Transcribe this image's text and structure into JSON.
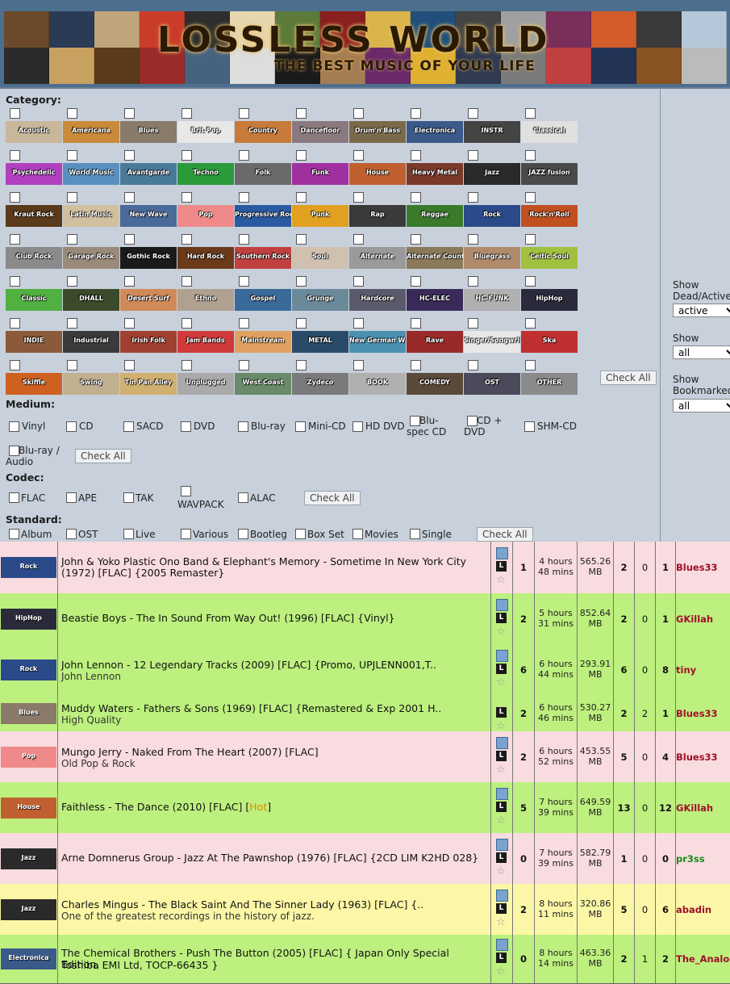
{
  "banner": {
    "title": "LOSSLESS WORLD",
    "subtitle": "THE BEST MUSIC OF YOUR LIFE",
    "colors": [
      "#6a4a2a",
      "#2b3a55",
      "#bfa57a",
      "#c93c2a",
      "#2e2e2e",
      "#e7d7b0",
      "#5c7a3a",
      "#8b1e1e",
      "#d9b44a",
      "#1f4f7a",
      "#444444",
      "#a0a0a0",
      "#7a2e5a",
      "#d35d2a",
      "#3a3a3a",
      "#b5c7d8",
      "#2a2a2a",
      "#c8a060",
      "#5a3a1a",
      "#9b2a2a",
      "#46627e",
      "#ddd",
      "#1a1a1a",
      "#a67c52",
      "#6a2a6a",
      "#e0b030",
      "#303a50",
      "#7a7a7a",
      "#c04040",
      "#223355",
      "#885522",
      "#bbbbbb"
    ]
  },
  "filters": {
    "category_label": "Category:",
    "medium_label": "Medium:",
    "codec_label": "Codec:",
    "standard_label": "Standard:",
    "check_all": "Check All",
    "categories": [
      [
        {
          "n": "Acoustic",
          "c": "#c8b79a"
        },
        {
          "n": "Americana",
          "c": "#c98a3a"
        },
        {
          "n": "Blues",
          "c": "#8a7a6a"
        },
        {
          "n": "Brit Pop",
          "c": "#e8e8e8"
        },
        {
          "n": "Country",
          "c": "#c77a3a"
        },
        {
          "n": "Dancefloor",
          "c": "#8a7a80"
        },
        {
          "n": "Drum'n'Bass",
          "c": "#7a6a4a"
        },
        {
          "n": "Electronica",
          "c": "#3a5a8a"
        },
        {
          "n": "INSTR",
          "c": "#444444"
        },
        {
          "n": "Classical",
          "c": "#e0e0e0"
        }
      ],
      [
        {
          "n": "Psychedelic",
          "c": "#b040c0"
        },
        {
          "n": "World Music",
          "c": "#5a90c0"
        },
        {
          "n": "Avantgarde",
          "c": "#4a7a9a"
        },
        {
          "n": "Techno",
          "c": "#2a9a3a"
        },
        {
          "n": "Folk",
          "c": "#6a6a6a"
        },
        {
          "n": "Funk",
          "c": "#a030a0"
        },
        {
          "n": "House",
          "c": "#c06030"
        },
        {
          "n": "Heavy Metal",
          "c": "#7a3a2a"
        },
        {
          "n": "Jazz",
          "c": "#2a2a2a"
        },
        {
          "n": "JAZZ fusion",
          "c": "#4a4a4a"
        }
      ],
      [
        {
          "n": "Kraut Rock",
          "c": "#5a3a1a"
        },
        {
          "n": "Latin Music",
          "c": "#d0c0a0"
        },
        {
          "n": "New Wave",
          "c": "#4a6a9a"
        },
        {
          "n": "Pop",
          "c": "#f08a8a"
        },
        {
          "n": "Progressive Rock",
          "c": "#2a5aa0"
        },
        {
          "n": "Punk",
          "c": "#e0a020"
        },
        {
          "n": "Rap",
          "c": "#3a3a3a"
        },
        {
          "n": "Reggae",
          "c": "#3a7a2a"
        },
        {
          "n": "Rock",
          "c": "#2a4a8a"
        },
        {
          "n": "Rock'n'Roll",
          "c": "#c05020"
        }
      ],
      [
        {
          "n": "Club Rock",
          "c": "#8a8a8a"
        },
        {
          "n": "Garage Rock",
          "c": "#9a8a7a"
        },
        {
          "n": "Gothic Rock",
          "c": "#1a1a1a"
        },
        {
          "n": "Hard Rock",
          "c": "#6a3a1a"
        },
        {
          "n": "Southern Rock",
          "c": "#c04040"
        },
        {
          "n": "Soul",
          "c": "#d0c0b0"
        },
        {
          "n": "Alternate",
          "c": "#9a9a9a"
        },
        {
          "n": "Alternate Country",
          "c": "#8a7a5a"
        },
        {
          "n": "Bluegrass",
          "c": "#b08a6a"
        },
        {
          "n": "Celtic Soul",
          "c": "#a0c040"
        }
      ],
      [
        {
          "n": "Classic",
          "c": "#50b040"
        },
        {
          "n": "DHALL",
          "c": "#3a4a2a"
        },
        {
          "n": "Desert Surf",
          "c": "#d08a5a"
        },
        {
          "n": "Ethno",
          "c": "#b0a090"
        },
        {
          "n": "Gospel",
          "c": "#3a6a9a"
        },
        {
          "n": "Grunge",
          "c": "#6a8a9a"
        },
        {
          "n": "Hardcore",
          "c": "#5a5a6a"
        },
        {
          "n": "HC-ELEC",
          "c": "#3a2a5a"
        },
        {
          "n": "HC-FUNK",
          "c": "#b0b0b0"
        },
        {
          "n": "HipHop",
          "c": "#2a2a3a"
        }
      ],
      [
        {
          "n": "INDIE",
          "c": "#8a5a3a"
        },
        {
          "n": "Industrial",
          "c": "#3a3a3a"
        },
        {
          "n": "Irish Folk",
          "c": "#a04030"
        },
        {
          "n": "Jam Bands",
          "c": "#d03a3a"
        },
        {
          "n": "Mainstream",
          "c": "#e0a060"
        },
        {
          "n": "METAL",
          "c": "#2a4a6a"
        },
        {
          "n": "New German Wave",
          "c": "#4a90b0"
        },
        {
          "n": "Rave",
          "c": "#9a2a2a"
        },
        {
          "n": "Singer/Songwriter",
          "c": "#e8e8e8"
        },
        {
          "n": "Ska",
          "c": "#c03030"
        }
      ],
      [
        {
          "n": "Skiffle",
          "c": "#d06020"
        },
        {
          "n": "Swing",
          "c": "#c0b090"
        },
        {
          "n": "Tin Pan Alley",
          "c": "#d0b070"
        },
        {
          "n": "Unplugged",
          "c": "#aaaaaa"
        },
        {
          "n": "West Coast",
          "c": "#6a8a6a"
        },
        {
          "n": "Zydeco",
          "c": "#7a7a7a"
        },
        {
          "n": "BOOK",
          "c": "#b0b0b0"
        },
        {
          "n": "COMEDY",
          "c": "#5a4a3a"
        },
        {
          "n": "OST",
          "c": "#4a4a5a"
        },
        {
          "n": "OTHER",
          "c": "#8a8a8a"
        }
      ]
    ],
    "mediums": [
      "Vinyl",
      "CD",
      "SACD",
      "DVD",
      "Blu-ray",
      "Mini-CD",
      "HD DVD",
      "Blu-spec CD",
      "CD + DVD",
      "SHM-CD",
      "Blu-ray / Audio"
    ],
    "codecs": [
      "FLAC",
      "APE",
      "TAK",
      "WAVPACK",
      "ALAC"
    ],
    "standards": [
      "Album",
      "OST",
      "Live",
      "Various",
      "Bootleg",
      "Box Set",
      "Movies",
      "Single"
    ]
  },
  "side": {
    "dead_label": "Show Dead/Active?",
    "dead_value": "active",
    "promo_label": "Show Promo?",
    "promo_value": "all",
    "bookmarked_label": "Show Bookmarked?",
    "bookmarked_value": "all"
  },
  "torrents": [
    {
      "cat": "Rock",
      "catc": "#2a4a8a",
      "title": "John & Yoko Plastic Ono Band & Elephant's Memory - Sometime In New York City (1972) [FLAC] {2005 Remaster}",
      "title2": "",
      "sub": "",
      "a": "1",
      "time": "4 hours 48 mins",
      "size": "565.26 MB",
      "s": "2",
      "l": "0",
      "c": "1",
      "user": "Blues33",
      "uc": "#a0102a",
      "bg": "#f9dcdf"
    },
    {
      "cat": "HipHop",
      "catc": "#2a2a3a",
      "title": "Beastie Boys - The In Sound From Way Out! (1996) [FLAC] {Vinyl}",
      "title2": "",
      "sub": "",
      "a": "2",
      "time": "5 hours 31 mins",
      "size": "852.64 MB",
      "s": "2",
      "l": "0",
      "c": "1",
      "user": "GKillah",
      "uc": "#a0102a",
      "bg": "#bdf07e"
    },
    {
      "cat": "Rock",
      "catc": "#2a4a8a",
      "title": "John Lennon - 12 Legendary Tracks (2009) [FLAC] {Promo, UPJLENN001,T..",
      "title2": "",
      "sub": "John Lennon",
      "a": "6",
      "time": "6 hours 44 mins",
      "size": "293.91 MB",
      "s": "6",
      "l": "0",
      "c": "8",
      "user": "tiny",
      "uc": "#a0102a",
      "bg": "#bdf07e"
    },
    {
      "cat": "Blues",
      "catc": "#8a7a6a",
      "title": "Muddy Waters - Fathers & Sons (1969) [FLAC] {Remastered & Exp 2001 H..",
      "title2": "",
      "sub": "High Quality",
      "a": "2",
      "time": "6 hours 46 mins",
      "size": "530.27 MB",
      "s": "2",
      "l": "2",
      "c": "1",
      "user": "Blues33",
      "uc": "#a0102a",
      "bg": "#bdf07e"
    },
    {
      "cat": "Pop",
      "catc": "#f08a8a",
      "title": "Mungo Jerry - Naked From The Heart (2007) [FLAC]",
      "title2": "",
      "sub": "Old Pop & Rock",
      "a": "2",
      "time": "6 hours 52 mins",
      "size": "453.55 MB",
      "s": "5",
      "l": "0",
      "c": "4",
      "user": "Blues33",
      "uc": "#a0102a",
      "bg": "#f9dcdf"
    },
    {
      "cat": "House",
      "catc": "#c06030",
      "title": "Faithless - The Dance (2010) [FLAC] [",
      "hot": "Hot",
      "title_end": "]",
      "title2": "",
      "sub": "",
      "a": "5",
      "time": "7 hours 39 mins",
      "size": "649.59 MB",
      "s": "13",
      "l": "0",
      "c": "12",
      "user": "GKillah",
      "uc": "#a0102a",
      "bg": "#bdf07e"
    },
    {
      "cat": "Jazz",
      "catc": "#2a2a2a",
      "title": "Arne Domnerus Group - Jazz At The Pawnshop (1976) [FLAC] {2CD LIM K2HD 028}",
      "title2": "",
      "sub": "",
      "a": "0",
      "time": "7 hours 39 mins",
      "size": "582.79 MB",
      "s": "1",
      "l": "0",
      "c": "0",
      "user": "pr3ss",
      "uc": "#1a8a1a",
      "bg": "#f9dcdf"
    },
    {
      "cat": "Jazz",
      "catc": "#2a2a2a",
      "title": "Charles Mingus - The Black Saint And The Sinner Lady (1963) [FLAC] {..",
      "title2": "",
      "sub": "One of the greatest recordings in the history of jazz.",
      "a": "2",
      "time": "8 hours 11 mins",
      "size": "320.86 MB",
      "s": "5",
      "l": "0",
      "c": "6",
      "user": "abadin",
      "uc": "#a0102a",
      "bg": "#fbf7a6"
    },
    {
      "cat": "Electronica",
      "catc": "#3a5a8a",
      "title": "The Chemical Brothers - Push The Button (2005) [FLAC] { Japan Only Special Edition,",
      "title2": "Toshiba EMI Ltd, TOCP-66435 }",
      "sub": "",
      "a": "0",
      "time": "8 hours 14 mins",
      "size": "463.36 MB",
      "s": "2",
      "l": "1",
      "c": "2",
      "user": "The_Analog",
      "uc": "#a0102a",
      "bg": "#bdf07e"
    }
  ]
}
